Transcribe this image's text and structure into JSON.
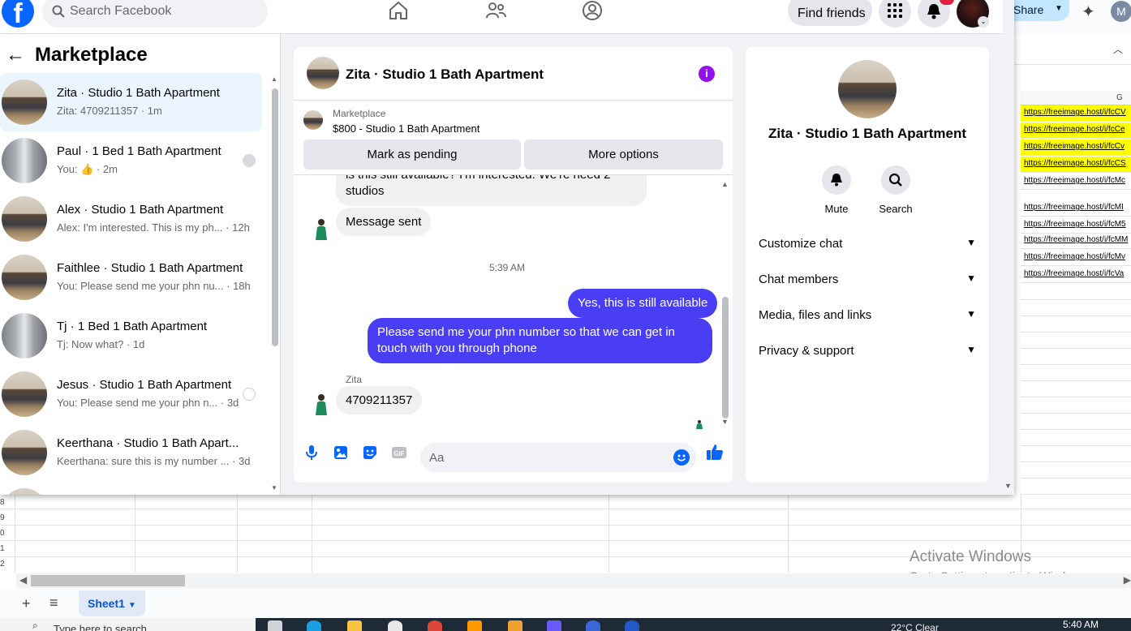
{
  "facebook": {
    "search_placeholder": "Search Facebook",
    "find_friends_label": "Find friends",
    "marketplace_title": "Marketplace",
    "conversations": [
      {
        "title": "Zita · Studio 1 Bath Apartment",
        "subtitle": "Zita: 4709211357 · 1m",
        "thumb": "apt"
      },
      {
        "title": "Paul · 1 Bed 1 Bath Apartment",
        "subtitle_prefix": "You: ",
        "subtitle_suffix": " · 2m",
        "thumb": "bath"
      },
      {
        "title": "Alex · Studio 1 Bath Apartment",
        "subtitle": "Alex: I'm interested. This is my ph...",
        "time": "· 12h",
        "thumb": "apt"
      },
      {
        "title": "Faithlee · Studio 1 Bath Apartment",
        "subtitle": "You: Please send me your phn nu...",
        "time": "· 18h",
        "thumb": "apt"
      },
      {
        "title": "Tj · 1 Bed 1 Bath Apartment",
        "subtitle": "Tj: Now what? · 1d",
        "thumb": "bath"
      },
      {
        "title": "Jesus · Studio 1 Bath Apartment",
        "subtitle": "You: Please send me your phn n...",
        "time": "· 3d",
        "thumb": "apt"
      },
      {
        "title": "Keerthana · Studio 1 Bath Apart...",
        "subtitle": "Keerthana: sure this is my number ...",
        "time": "· 3d",
        "thumb": "apt"
      }
    ],
    "chat": {
      "title": "Zita · Studio 1 Bath Apartment",
      "listing_source": "Marketplace",
      "listing_title": "$800 - Studio 1 Bath Apartment",
      "mark_pending_label": "Mark as pending",
      "more_options_label": "More options",
      "partial_message_line1": "is this still available? I'm interested. We're need 2",
      "partial_message_line2": "studios",
      "message_sent": "Message sent",
      "timestamp": "5:39 AM",
      "out_message_1": "Yes, this is still available",
      "out_message_2_line1": "Please send me your phn number so that we can get in",
      "out_message_2_line2": "touch with you through phone",
      "sender_name": "Zita",
      "in_message_phone": "4709211357",
      "composer_placeholder": "Aa"
    },
    "info_panel": {
      "name": "Zita · Studio 1 Bath Apartment",
      "mute_label": "Mute",
      "search_label": "Search",
      "sections": [
        "Customize chat",
        "Chat members",
        "Media, files and links",
        "Privacy & support"
      ]
    }
  },
  "sheets": {
    "share_label": "Share",
    "account_initial": "M",
    "column_letter": "G",
    "links": [
      {
        "text": "https://freeimage.host/i/fcCV",
        "highlight": true
      },
      {
        "text": "https://freeimage.host/i/fcCe",
        "highlight": true
      },
      {
        "text": "https://freeimage.host/i/fcCv",
        "highlight": true
      },
      {
        "text": "https://freeimage.host/i/fcCS",
        "highlight": true
      },
      {
        "text": "https://freeimage.host/i/fcMc",
        "highlight": false
      },
      {
        "text": "https://freeimage.host/i/fcMI",
        "highlight": false
      },
      {
        "text": "https://freeimage.host/i/fcM5",
        "highlight": false
      },
      {
        "text": "https://freeimage.host/i/fcMM",
        "highlight": false
      },
      {
        "text": "https://freeimage.host/i/fcMv",
        "highlight": false
      },
      {
        "text": "https://freeimage.host/i/fcVa",
        "highlight": false
      }
    ],
    "row_numbers": [
      "8",
      "9",
      "0",
      "1",
      "2"
    ],
    "sheet_tab": "Sheet1",
    "activate_title": "Activate Windows",
    "activate_sub": "Go to Settings to activate Windows."
  },
  "taskbar": {
    "search_placeholder": "Type here to search",
    "weather": "22°C  Clear",
    "clock": "5:40 AM"
  }
}
